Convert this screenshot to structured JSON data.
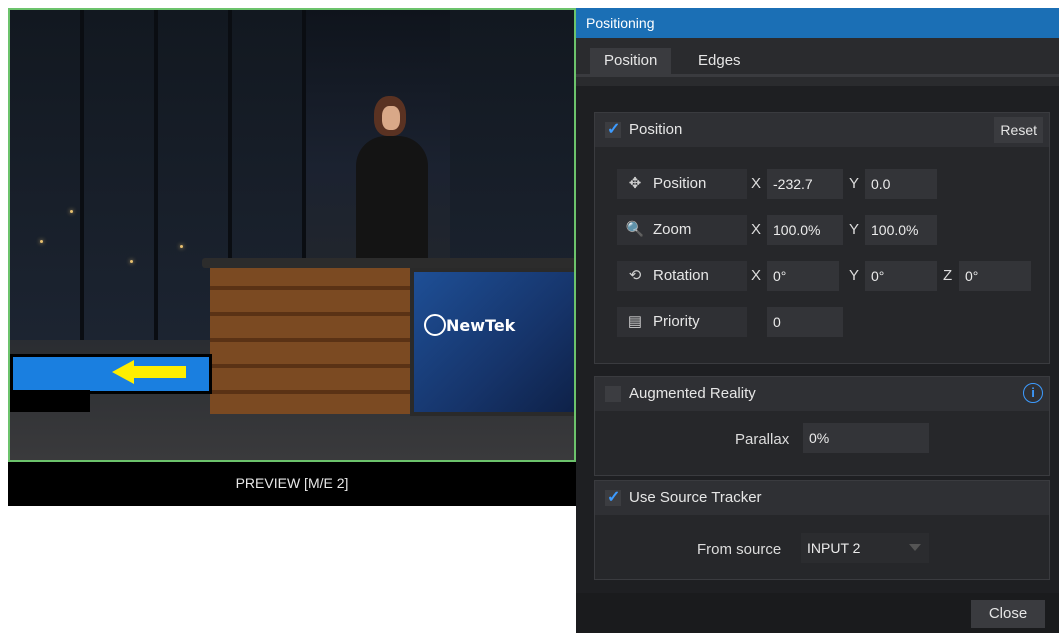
{
  "preview": {
    "label": "PREVIEW [M/E 2]",
    "logo_text": "NewTek"
  },
  "panel": {
    "title": "Positioning",
    "tabs": [
      "Position",
      "Edges"
    ],
    "active_tab": "Position",
    "position_group": {
      "title": "Position",
      "checked": true,
      "reset_label": "Reset",
      "rows": {
        "position": {
          "label": "Position",
          "icon": "move-icon",
          "x_axis": "X",
          "x": "-232.7",
          "y_axis": "Y",
          "y": "0.0"
        },
        "zoom": {
          "label": "Zoom",
          "icon": "zoom-icon",
          "x_axis": "X",
          "x": "100.0%",
          "y_axis": "Y",
          "y": "100.0%"
        },
        "rotation": {
          "label": "Rotation",
          "icon": "rotation-icon",
          "x_axis": "X",
          "x": "0°",
          "y_axis": "Y",
          "y": "0°",
          "z_axis": "Z",
          "z": "0°"
        },
        "priority": {
          "label": "Priority",
          "icon": "layers-icon",
          "value": "0"
        }
      }
    },
    "ar_group": {
      "title": "Augmented Reality",
      "checked": false,
      "parallax_label": "Parallax",
      "parallax": "0%"
    },
    "tracker_group": {
      "title": "Use Source Tracker",
      "checked": true,
      "source_label": "From source",
      "source": "INPUT 2"
    },
    "close_label": "Close"
  },
  "colors": {
    "titlebar": "#1b6fb5",
    "accent": "#3d9bff",
    "preview_border": "#6cc36c",
    "lower_third": "#1a7fe0",
    "arrow": "#ffee00"
  }
}
